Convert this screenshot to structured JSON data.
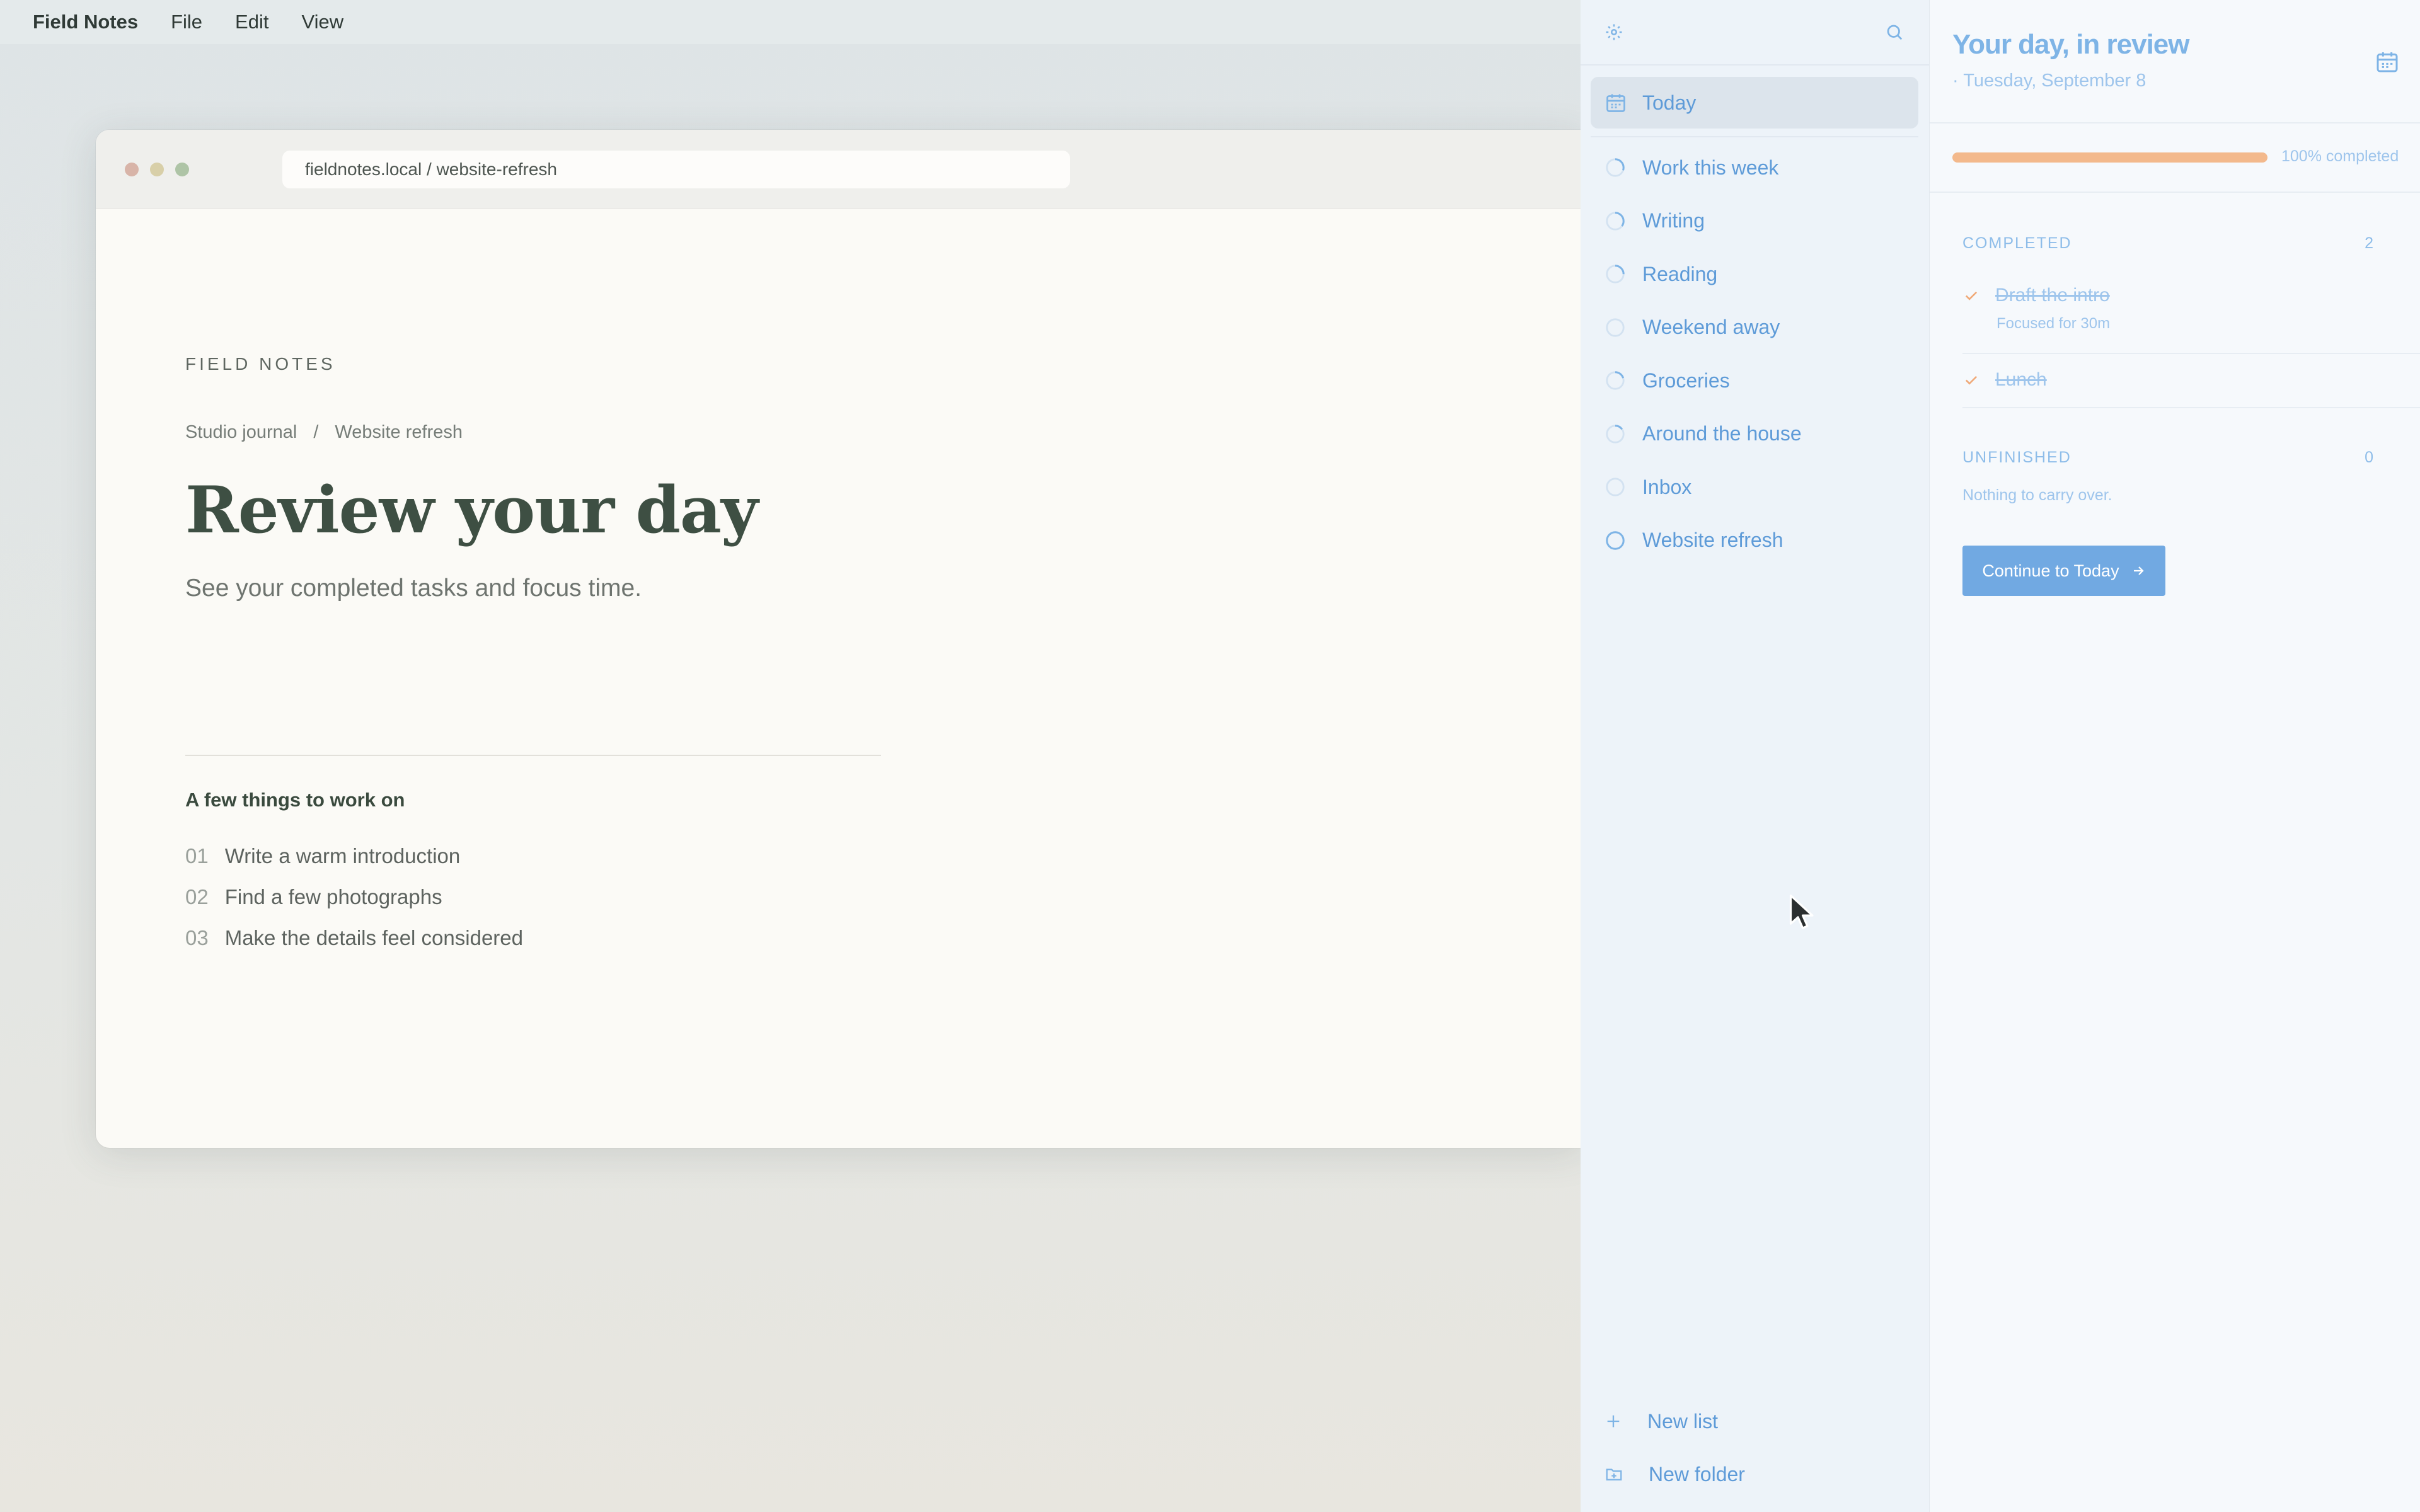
{
  "menubar": {
    "app_name": "Field Notes",
    "items": [
      "File",
      "Edit",
      "View"
    ]
  },
  "browser": {
    "url": "fieldnotes.local / website-refresh"
  },
  "page": {
    "eyebrow": "FIELD NOTES",
    "breadcrumb": [
      "Studio journal",
      "/",
      "Website refresh"
    ],
    "title": "Review your day",
    "subtitle": "See your completed tasks and focus time.",
    "things_title": "A few things to work on",
    "things": [
      {
        "num": "01",
        "text": "Write a warm introduction"
      },
      {
        "num": "02",
        "text": "Find a few photographs"
      },
      {
        "num": "03",
        "text": "Make the details feel considered"
      }
    ]
  },
  "sidebar": {
    "top_icons": [
      "gear-icon",
      "search-icon"
    ],
    "today": {
      "label": "Today",
      "icon": "calendar-icon"
    },
    "lists": [
      {
        "label": "Work this week",
        "progress": 0.3
      },
      {
        "label": "Writing",
        "progress": 0.35
      },
      {
        "label": "Reading",
        "progress": 0.25
      },
      {
        "label": "Weekend away",
        "progress": 0
      },
      {
        "label": "Groceries",
        "progress": 0.2
      },
      {
        "label": "Around the house",
        "progress": 0.15
      },
      {
        "label": "Inbox",
        "progress": 0
      },
      {
        "label": "Website refresh",
        "progress": 1
      }
    ],
    "new_list": "New list",
    "new_folder": "New folder"
  },
  "review": {
    "title": "Your day, in review",
    "date": "· Tuesday, September 8",
    "progress_fraction": 1.0,
    "progress_text": "100% completed",
    "completed_label": "COMPLETED",
    "completed_count": "2",
    "completed_items": [
      {
        "text": "Draft the intro",
        "sub": "Focused for 30m"
      },
      {
        "text": "Lunch",
        "sub": ""
      }
    ],
    "unfinished_label": "UNFINISHED",
    "unfinished_count": "0",
    "unfinished_empty": "Nothing to carry over.",
    "continue_label": "Continue to Today"
  },
  "colors": {
    "accent": "#71a9e2",
    "accent_text": "#5e9bd8",
    "progress": "#f3b98c",
    "headline": "#3e4f43"
  }
}
